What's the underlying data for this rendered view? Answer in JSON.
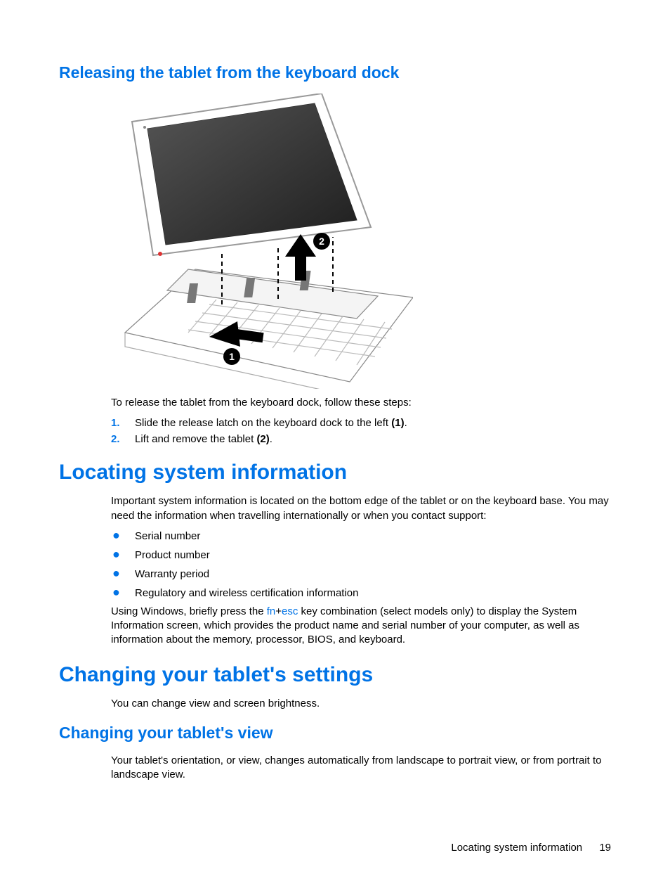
{
  "section1": {
    "heading": "Releasing the tablet from the keyboard dock",
    "intro": "To release the tablet from the keyboard dock, follow these steps:",
    "steps": [
      {
        "num": "1.",
        "textA": "Slide the release latch on the keyboard dock to the left ",
        "bold": "(1)",
        "textB": "."
      },
      {
        "num": "2.",
        "textA": "Lift and remove the tablet ",
        "bold": "(2)",
        "textB": "."
      }
    ]
  },
  "section2": {
    "heading": "Locating system information",
    "para1": "Important system information is located on the bottom edge of the tablet or on the keyboard base. You may need the information when travelling internationally or when you contact support:",
    "bullets": [
      "Serial number",
      "Product number",
      "Warranty period",
      "Regulatory and wireless certification information"
    ],
    "para2a": "Using Windows, briefly press the ",
    "key1": "fn",
    "plus": "+",
    "key2": "esc",
    "para2b": " key combination (select models only) to display the System Information screen, which provides the product name and serial number of your computer, as well as information about the memory, processor, BIOS, and keyboard."
  },
  "section3": {
    "heading": "Changing your tablet's settings",
    "para": "You can change view and screen brightness."
  },
  "section4": {
    "heading": "Changing your tablet's view",
    "para": "Your tablet's orientation, or view, changes automatically from landscape to portrait view, or from portrait to landscape view."
  },
  "footer": {
    "title": "Locating system information",
    "page": "19"
  },
  "illu": {
    "marker1": "1",
    "marker2": "2"
  }
}
